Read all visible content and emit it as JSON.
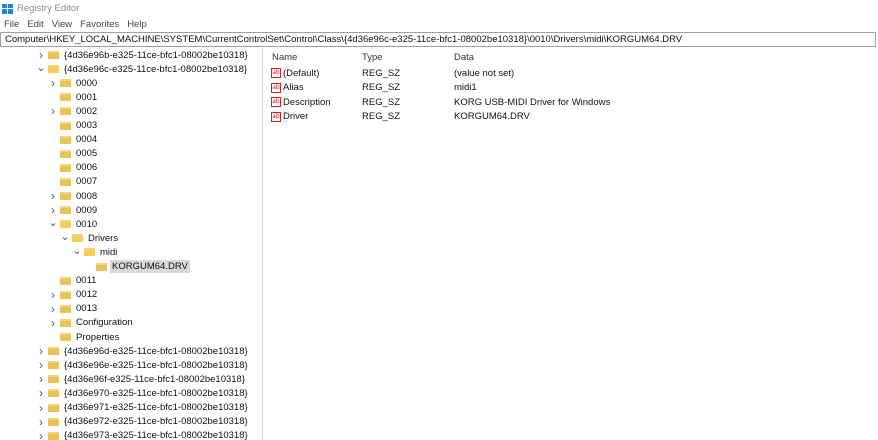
{
  "window": {
    "title": "Registry Editor",
    "app_icon": "registry-editor-icon"
  },
  "menu": [
    "File",
    "Edit",
    "View",
    "Favorites",
    "Help"
  ],
  "address": "Computer\\HKEY_LOCAL_MACHINE\\SYSTEM\\CurrentControlSet\\Control\\Class\\{4d36e96c-e325-11ce-bfc1-08002be10318}\\0010\\Drivers\\midi\\KORGUM64.DRV",
  "tree": [
    {
      "label": "{4d36e96b-e325-11ce-bfc1-08002be10318}",
      "level": 0,
      "toggle": ">"
    },
    {
      "label": "{4d36e96c-e325-11ce-bfc1-08002be10318}",
      "level": 0,
      "toggle": "v"
    },
    {
      "label": "0000",
      "level": 1,
      "toggle": ">"
    },
    {
      "label": "0001",
      "level": 1,
      "toggle": ""
    },
    {
      "label": "0002",
      "level": 1,
      "toggle": ">"
    },
    {
      "label": "0003",
      "level": 1,
      "toggle": ""
    },
    {
      "label": "0004",
      "level": 1,
      "toggle": ""
    },
    {
      "label": "0005",
      "level": 1,
      "toggle": ""
    },
    {
      "label": "0006",
      "level": 1,
      "toggle": ""
    },
    {
      "label": "0007",
      "level": 1,
      "toggle": ""
    },
    {
      "label": "0008",
      "level": 1,
      "toggle": ">"
    },
    {
      "label": "0009",
      "level": 1,
      "toggle": ">"
    },
    {
      "label": "0010",
      "level": 1,
      "toggle": "v"
    },
    {
      "label": "Drivers",
      "level": 2,
      "toggle": "v"
    },
    {
      "label": "midi",
      "level": 3,
      "toggle": "v"
    },
    {
      "label": "KORGUM64.DRV",
      "level": 4,
      "toggle": "",
      "selected": true
    },
    {
      "label": "0011",
      "level": 1,
      "toggle": ""
    },
    {
      "label": "0012",
      "level": 1,
      "toggle": ">"
    },
    {
      "label": "0013",
      "level": 1,
      "toggle": ">"
    },
    {
      "label": "Configuration",
      "level": 1,
      "toggle": ">"
    },
    {
      "label": "Properties",
      "level": 1,
      "toggle": ""
    },
    {
      "label": "{4d36e96d-e325-11ce-bfc1-08002be10318}",
      "level": 0,
      "toggle": ">"
    },
    {
      "label": "{4d36e96e-e325-11ce-bfc1-08002be10318}",
      "level": 0,
      "toggle": ">"
    },
    {
      "label": "{4d36e96f-e325-11ce-bfc1-08002be10318}",
      "level": 0,
      "toggle": ">"
    },
    {
      "label": "{4d36e970-e325-11ce-bfc1-08002be10318}",
      "level": 0,
      "toggle": ">"
    },
    {
      "label": "{4d36e971-e325-11ce-bfc1-08002be10318}",
      "level": 0,
      "toggle": ">"
    },
    {
      "label": "{4d36e972-e325-11ce-bfc1-08002be10318}",
      "level": 0,
      "toggle": ">"
    },
    {
      "label": "{4d36e973-e325-11ce-bfc1-08002be10318}",
      "level": 0,
      "toggle": ">"
    }
  ],
  "values": {
    "headers": {
      "name": "Name",
      "type": "Type",
      "data": "Data"
    },
    "rows": [
      {
        "name": "(Default)",
        "type": "REG_SZ",
        "data": "(value not set)"
      },
      {
        "name": "Alias",
        "type": "REG_SZ",
        "data": "midi1"
      },
      {
        "name": "Description",
        "type": "REG_SZ",
        "data": "KORG USB-MIDI Driver for Windows"
      },
      {
        "name": "Driver",
        "type": "REG_SZ",
        "data": "KORGUM64.DRV"
      }
    ],
    "icon": "string-value-icon",
    "icon_text": "ab"
  }
}
